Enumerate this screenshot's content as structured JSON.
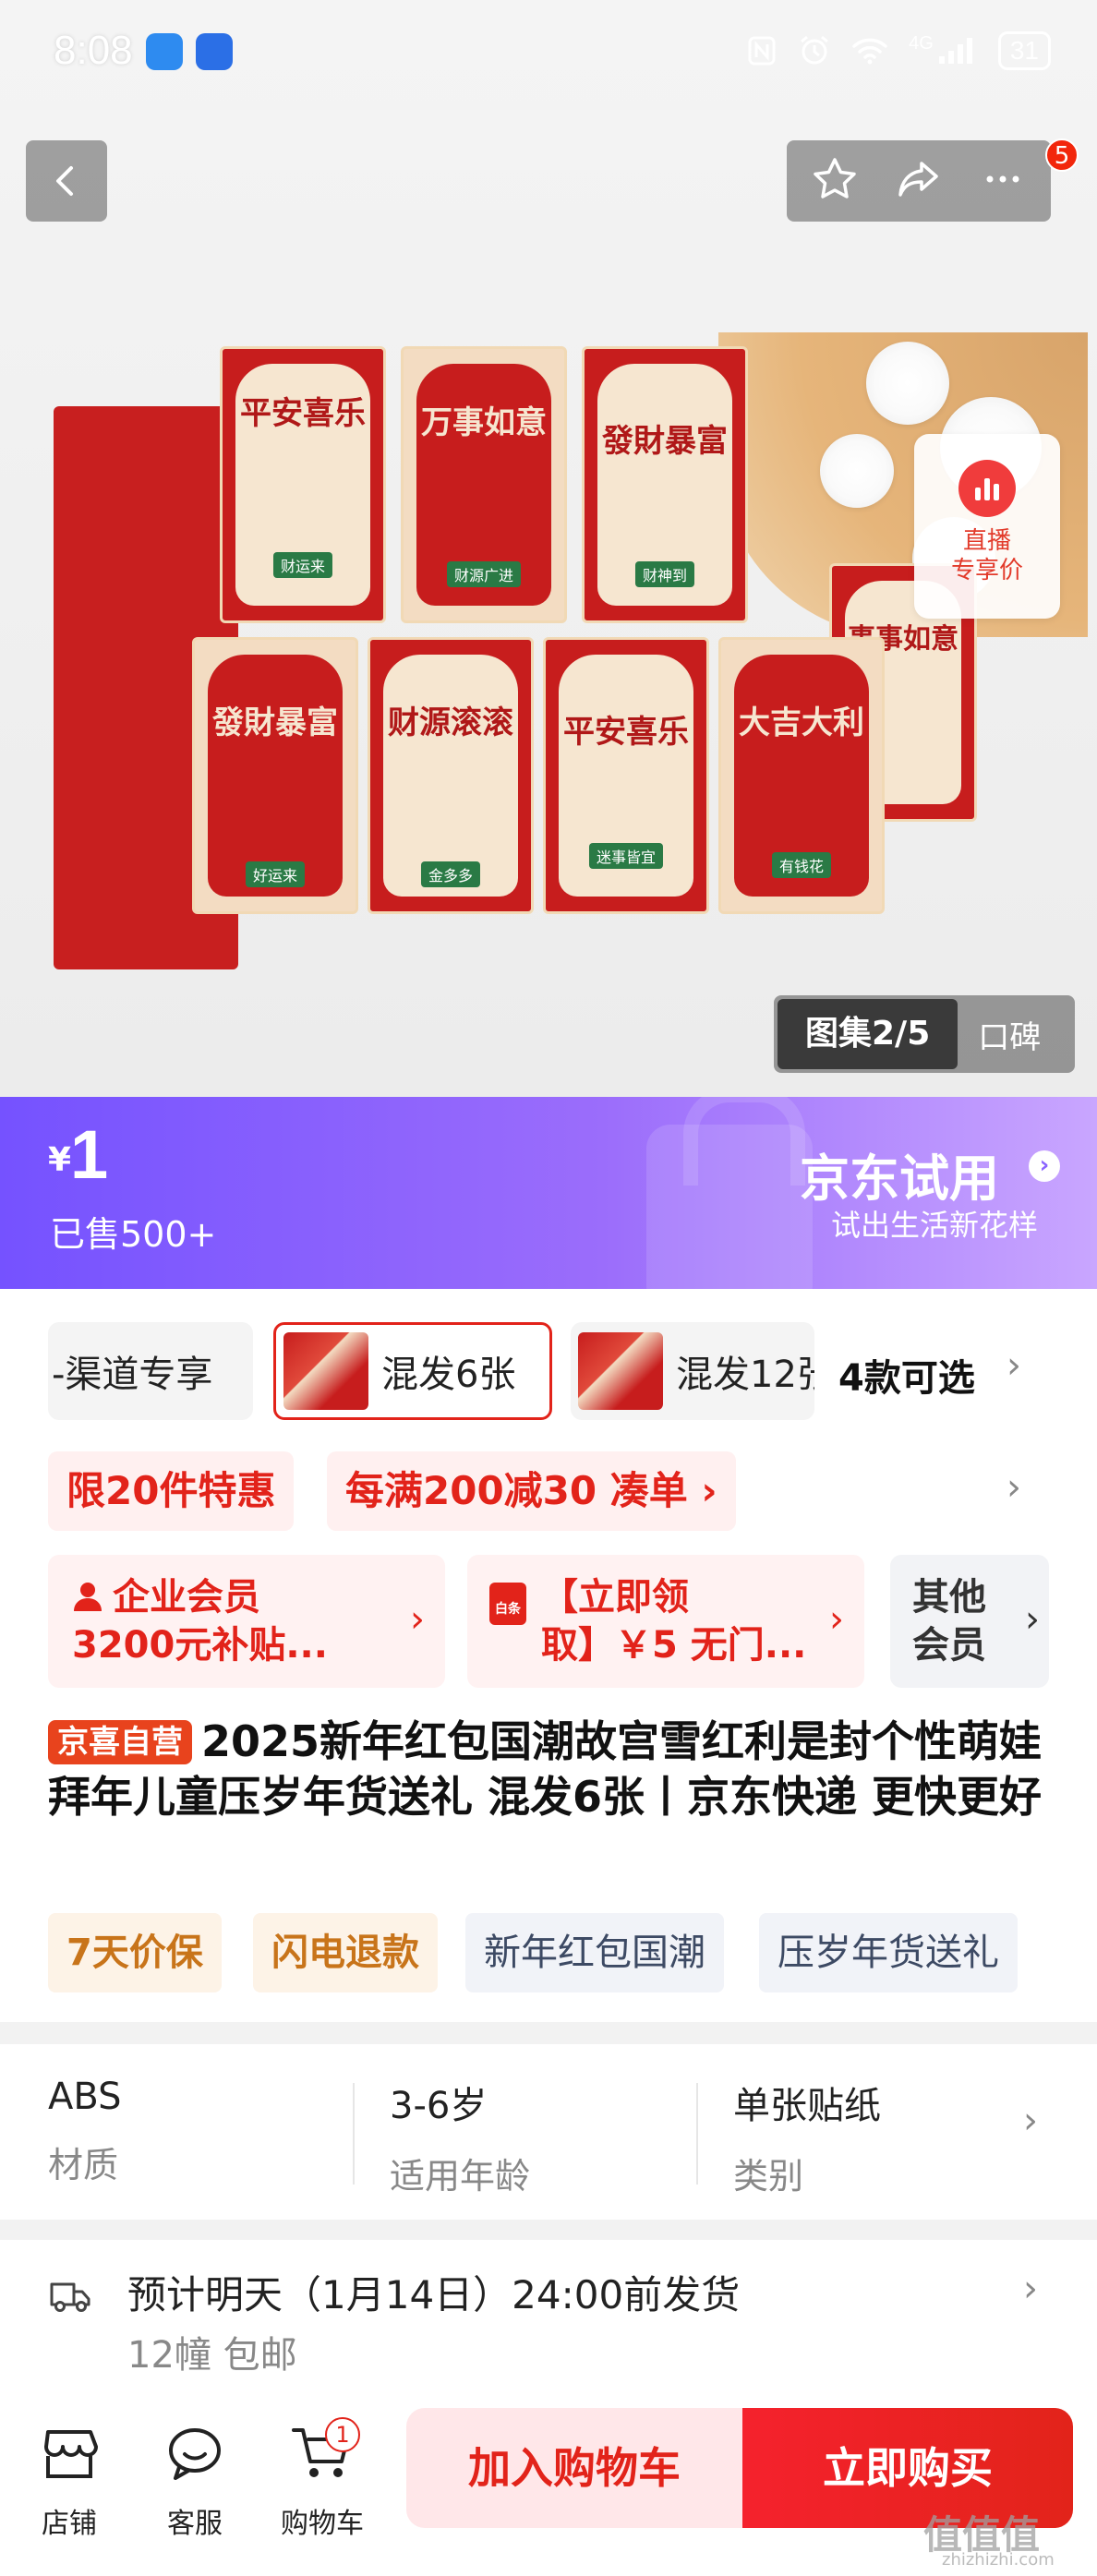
{
  "status_bar": {
    "time": "8:08",
    "network": "4G",
    "battery": "31",
    "wifi_icon": "wifi-icon",
    "signal_icon": "signal-icon"
  },
  "header": {
    "back_icon": "chevron-left-icon",
    "favorite_icon": "star-icon",
    "share_icon": "share-icon",
    "more_icon": "more-icon",
    "message_badge": "5"
  },
  "hero": {
    "live": {
      "line1": "直播",
      "line2": "专享价"
    },
    "gallery_tab": "图集2/5",
    "reviews_tab": "口碑"
  },
  "price_banner": {
    "currency": "¥",
    "price": "1",
    "sold": "已售500+",
    "trial_title": "京东试用",
    "trial_subtitle": "试出生活新花样",
    "gradient_start": "#7552ff",
    "gradient_end": "#c9a6ff"
  },
  "variants": {
    "items": [
      {
        "label": "-渠道专享"
      },
      {
        "label": "混发6张",
        "selected": true
      },
      {
        "label": "混发12张"
      }
    ],
    "count_label": "4款可选"
  },
  "promos": [
    {
      "label": "限20件特惠"
    },
    {
      "label": "每满200减30  凑单 ›"
    }
  ],
  "coupons": [
    {
      "line1": "企业会员",
      "line2": "3200元补贴..."
    },
    {
      "line1": "【立即领",
      "line2": "取】￥5 无门..."
    },
    {
      "line1": "其他",
      "line2": "会员"
    }
  ],
  "product": {
    "store_tag": "京喜自营",
    "title": "2025新年红包国潮故宫雪红利是封个性萌娃拜年儿童压岁年货送礼 混发6张丨京东快递 更快更好"
  },
  "tags": [
    {
      "label": "7天价保"
    },
    {
      "label": "闪电退款"
    },
    {
      "label": "新年红包国潮"
    },
    {
      "label": "压岁年货送礼"
    }
  ],
  "specs": [
    {
      "value": "ABS",
      "key": "材质"
    },
    {
      "value": "3-6岁",
      "key": "适用年龄"
    },
    {
      "value": "单张贴纸",
      "key": "类别"
    }
  ],
  "shipping": {
    "main": "预计明天（1月14日）24:00前发货",
    "sub": "12幢  包邮"
  },
  "bottom_bar": {
    "store": "店铺",
    "service": "客服",
    "cart": "购物车",
    "cart_badge": "1",
    "add_to_cart": "加入购物车",
    "buy_now": "立即购买",
    "accent": "#e2231a"
  },
  "watermark": {
    "main": "值值值",
    "sub": "zhizhizhi.com"
  },
  "artwork_text": {
    "p1": "平安喜乐",
    "p2": "万事如意",
    "p3": "發財暴富",
    "p4": "發財暴富",
    "p5": "财源滚滚",
    "p6": "平安喜乐",
    "p7": "大吉大利",
    "p8": "事事如意"
  }
}
